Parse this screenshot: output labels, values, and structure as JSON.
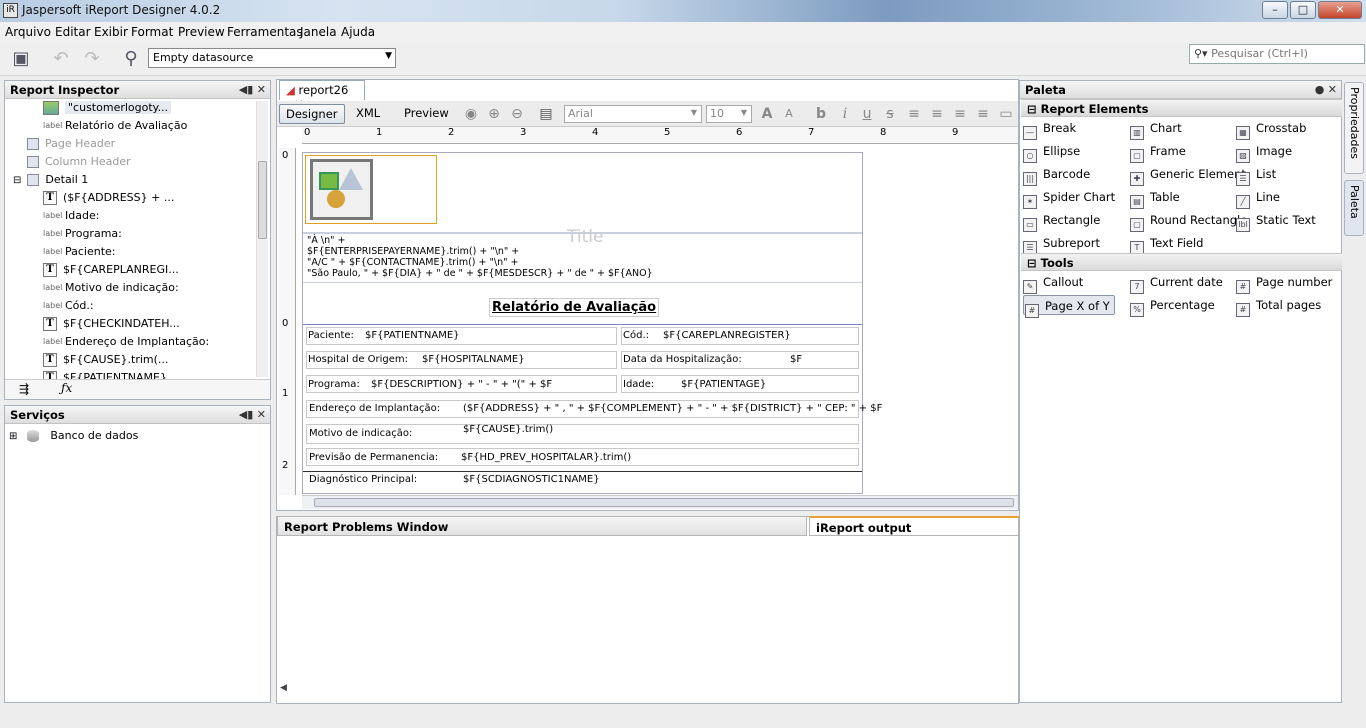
{
  "window": {
    "title": "Jaspersoft iReport Designer 4.0.2",
    "min": "–",
    "max": "□",
    "close": "✕"
  },
  "menu": [
    "Arquivo",
    "Editar",
    "Exibir",
    "Format",
    "Preview",
    "Ferramentas",
    "Janela",
    "Ajuda"
  ],
  "toolbar": {
    "datasource": "Empty datasource",
    "search_placeholder": "Pesquisar (Ctrl+I)"
  },
  "inspector": {
    "title": "Report Inspector",
    "rows": [
      {
        "label": "\"customerlogoty...",
        "icon": "img",
        "indent": 1
      },
      {
        "label": "Relatório de Avaliação",
        "icon": "label",
        "indent": 1
      },
      {
        "label": "Page Header",
        "icon": "band",
        "indent": 0,
        "gray": true
      },
      {
        "label": "Column Header",
        "icon": "band",
        "indent": 0,
        "gray": true
      },
      {
        "label": "Detail 1",
        "icon": "band",
        "indent": 0,
        "expander": "⊟"
      },
      {
        "label": "($F{ADDRESS} + ...",
        "icon": "T",
        "indent": 1
      },
      {
        "label": "Idade:",
        "icon": "label",
        "indent": 1
      },
      {
        "label": "Programa:",
        "icon": "label",
        "indent": 1
      },
      {
        "label": "Paciente:",
        "icon": "label",
        "indent": 1
      },
      {
        "label": "$F{CAREPLANREGI...",
        "icon": "T",
        "indent": 1
      },
      {
        "label": "Motivo de indicação:",
        "icon": "label",
        "indent": 1
      },
      {
        "label": "Cód.:",
        "icon": "label",
        "indent": 1
      },
      {
        "label": "$F{CHECKINDATEH...",
        "icon": "T",
        "indent": 1
      },
      {
        "label": "Endereço de Implantação:",
        "icon": "label",
        "indent": 1
      },
      {
        "label": "$F{CAUSE}.trim(...",
        "icon": "T",
        "indent": 1
      },
      {
        "label": "$F{PATIENTNAME}",
        "icon": "T",
        "indent": 1
      }
    ]
  },
  "services": {
    "title": "Serviços",
    "db": "Banco de dados"
  },
  "editor": {
    "tab": "report26",
    "modes": [
      "Designer",
      "XML",
      "Preview"
    ],
    "font": "Arial",
    "size": "10",
    "ruler_h": [
      "0",
      "1",
      "2",
      "3",
      "4",
      "5",
      "6",
      "7",
      "8",
      "9"
    ],
    "ruler_v": [
      "0",
      "0",
      "1",
      "2"
    ]
  },
  "report": {
    "title_band": "Title",
    "expr": [
      "\"À \\n\" +",
      "$F{ENTERPRISEPAYERNAME}.trim() + \"\\n\" +",
      "\"A/C  \" + $F{CONTACTNAME}.trim() + \"\\n\" +",
      "\"São Paulo, \" + $F{DIA} + \" de \" + $F{MESDESCR} + \" de \" + $F{ANO}"
    ],
    "heading": "Relatório de Avaliação",
    "rows": [
      {
        "l1": "Paciente:",
        "f1": "$F{PATIENTNAME}",
        "l2": "Cód.:",
        "f2": "$F{CAREPLANREGISTER}"
      },
      {
        "l1": "Hospital de Origem:",
        "f1": "$F{HOSPITALNAME}",
        "l2": "Data da Hospitalização:",
        "f2": "$F"
      },
      {
        "l1": "Programa:",
        "f1": "$F{DESCRIPTION} + \" - \" + \"(\" + $F",
        "l2": "Idade:",
        "f2": "$F{PATIENTAGE}"
      }
    ],
    "end_label": "Endereço de Implantação:",
    "end_field": "($F{ADDRESS} + \" , \" + $F{COMPLEMENT} + \" - \" + $F{DISTRICT} + \" CEP: \" + $F",
    "motivo_label": "Motivo de indicação:",
    "motivo_field": "$F{CAUSE}.trim()",
    "prev_label": "Previsão de Permanencia:",
    "prev_field": "$F{HD_PREV_HOSPITALAR}.trim()",
    "diag_label": "Diagnóstico Principal:",
    "diag_field": "$F{SCDIAGNOSTIC1NAME}"
  },
  "bottom_tabs": [
    "Report Problems Window",
    "iReport output"
  ],
  "palette": {
    "title": "Paleta",
    "section1": "Report Elements",
    "elements": [
      [
        "Break",
        "Chart",
        "Crosstab"
      ],
      [
        "Ellipse",
        "Frame",
        "Image"
      ],
      [
        "Barcode",
        "Generic Element",
        "List"
      ],
      [
        "Spider Chart",
        "Table",
        "Line"
      ],
      [
        "Rectangle",
        "Round Rectangle",
        "Static Text"
      ],
      [
        "Subreport",
        "Text Field",
        ""
      ]
    ],
    "section2": "Tools",
    "tools": [
      [
        "Callout",
        "Current date",
        "Page number"
      ],
      [
        "Page X of Y",
        "Percentage",
        "Total pages"
      ]
    ]
  },
  "side_tabs": [
    "Propriedades",
    "Paleta"
  ]
}
